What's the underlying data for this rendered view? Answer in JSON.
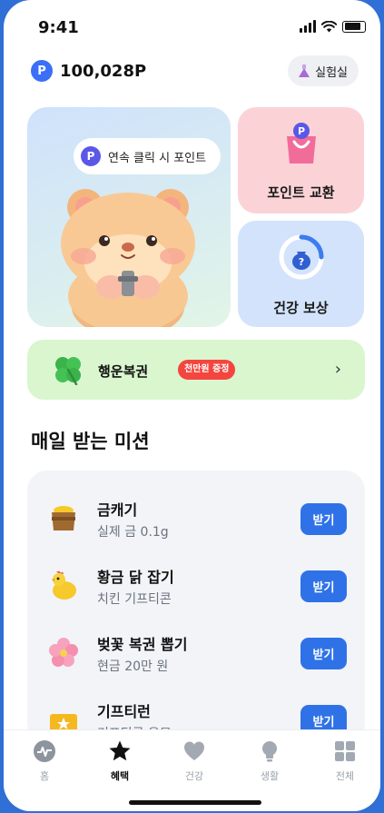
{
  "status": {
    "time": "9:41"
  },
  "points": {
    "badge": "P",
    "amount": "100,028P"
  },
  "lab": {
    "label": "실험실"
  },
  "click_card": {
    "badge": "P",
    "label": "연속 클릭 시 포인트"
  },
  "exchange_card": {
    "label": "포인트 교환"
  },
  "health_card": {
    "label": "건강 보상"
  },
  "lucky": {
    "title": "행운복권",
    "badge": "천만원 증정"
  },
  "missions_title": "매일 받는 미션",
  "missions": [
    {
      "name": "금캐기",
      "sub": "실제 금 0.1g",
      "button": "받기",
      "icon": "gold-pot-icon"
    },
    {
      "name": "황금 닭 잡기",
      "sub": "치킨 기프티콘",
      "button": "받기",
      "icon": "chicken-icon"
    },
    {
      "name": "벚꽃 복권 뽑기",
      "sub": "현금 20만 원",
      "button": "받기",
      "icon": "cherry-blossom-icon"
    },
    {
      "name": "기프티런",
      "sub": "기프티콘 응모",
      "button": "받기",
      "icon": "ticket-icon"
    }
  ],
  "tabs": [
    {
      "label": "홈",
      "icon": "heartbeat-icon"
    },
    {
      "label": "혜택",
      "icon": "star-icon"
    },
    {
      "label": "건강",
      "icon": "heart-icon"
    },
    {
      "label": "생활",
      "icon": "lightbulb-icon"
    },
    {
      "label": "전체",
      "icon": "grid-icon"
    }
  ],
  "colors": {
    "accent": "#2f72e8",
    "background_frame": "#2f6fd6",
    "lucky_badge": "#f4453f"
  }
}
